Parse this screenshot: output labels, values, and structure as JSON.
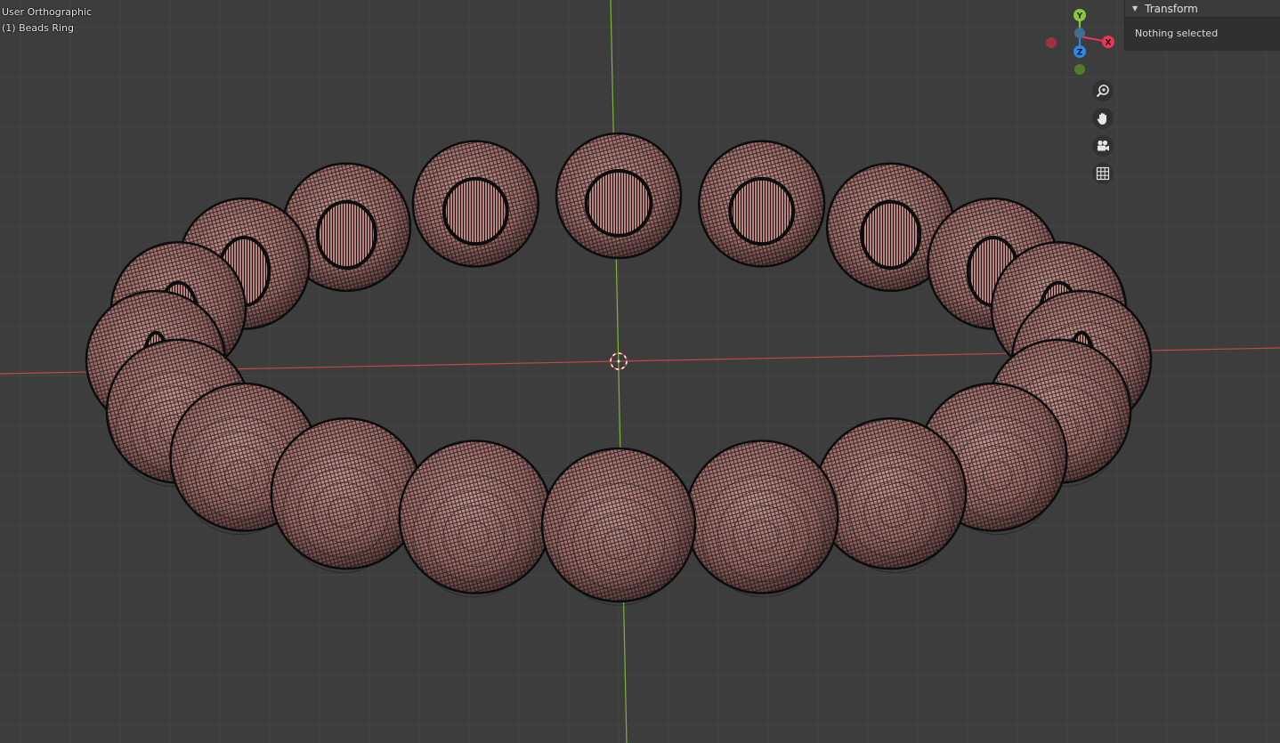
{
  "viewport": {
    "view_name": "User Orthographic",
    "object_name": "(1) Beads Ring"
  },
  "gizmo": {
    "x_label": "X",
    "y_label": "Y",
    "z_label": "Z",
    "x_color": "#e8375a",
    "y_color": "#8cc63f",
    "z_color": "#2e88e8"
  },
  "nav_tools": [
    {
      "icon": "zoom-icon"
    },
    {
      "icon": "hand-pan-icon"
    },
    {
      "icon": "camera-icon"
    },
    {
      "icon": "grid-icon"
    }
  ],
  "sidebar": {
    "panel_title": "Transform",
    "panel_message": "Nothing selected"
  },
  "scene": {
    "bead_count": 20,
    "bead_color": "#b07a76",
    "wire_color": "#141414",
    "x_axis_color": "#c4464f",
    "y_axis_color": "#7fb239"
  }
}
